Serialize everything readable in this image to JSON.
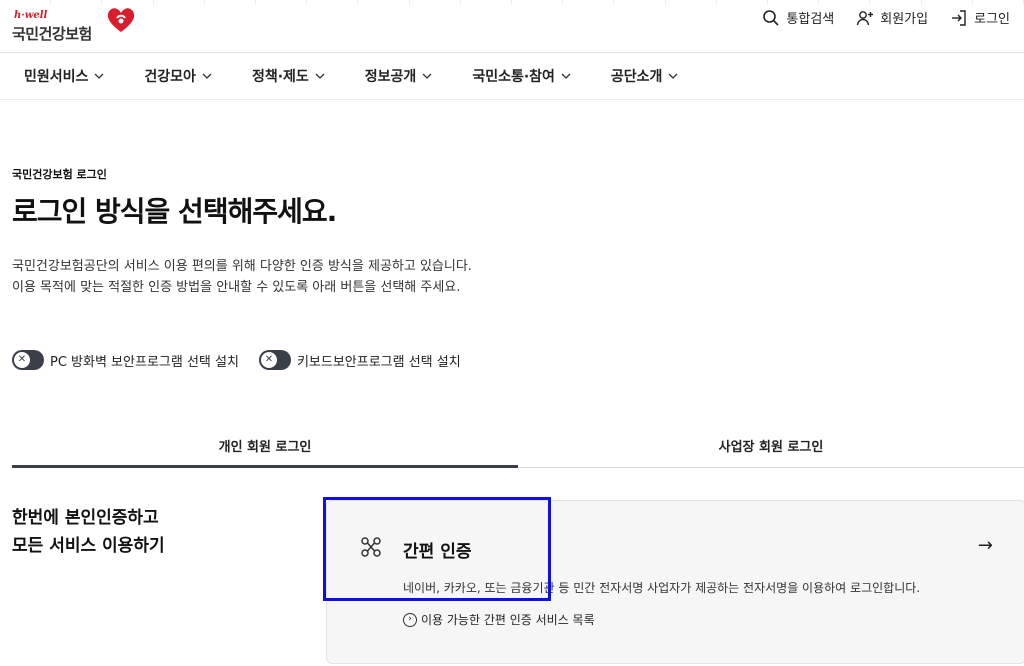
{
  "header": {
    "logo_hwell": "h·well",
    "logo_name": "국민건강보험",
    "utils": [
      {
        "label": "통합검색",
        "icon": "search-icon"
      },
      {
        "label": "회원가입",
        "icon": "user-plus-icon"
      },
      {
        "label": "로그인",
        "icon": "login-icon"
      }
    ]
  },
  "nav": [
    {
      "label": "민원서비스"
    },
    {
      "label": "건강모아"
    },
    {
      "label": "정책·제도"
    },
    {
      "label": "정보공개"
    },
    {
      "label": "국민소통·참여"
    },
    {
      "label": "공단소개"
    }
  ],
  "page": {
    "small_title": "국민건강보험 로그인",
    "title": "로그인 방식을 선택해주세요.",
    "desc_line1": "국민건강보험공단의 서비스 이용 편의를 위해 다양한 인증 방식을 제공하고 있습니다.",
    "desc_line2": "이용 목적에 맞는 적절한 인증 방법을 안내할 수 있도록 아래 버튼을 선택해 주세요."
  },
  "toggles": [
    {
      "label": "PC 방화벽 보안프로그램 선택 설치"
    },
    {
      "label": "키보드보안프로그램 선택 설치"
    }
  ],
  "tabs": [
    {
      "label": "개인 회원 로그인",
      "active": true
    },
    {
      "label": "사업장 회원 로그인",
      "active": false
    }
  ],
  "section": {
    "tagline_line1": "한번에 본인인증하고",
    "tagline_line2": "모든 서비스 이용하기"
  },
  "card": {
    "title": "간편 인증",
    "arrow": "→",
    "desc": "네이버, 카카오, 또는 금융기관 등 민간 전자서명 사업자가 제공하는 전자서명을 이용하여 로그인합니다.",
    "link": "이용 가능한 간편 인증 서비스 목록"
  },
  "colors": {
    "brand_red": "#d81e2c",
    "dark": "#3a3f4a",
    "highlight": "#1010e6"
  }
}
